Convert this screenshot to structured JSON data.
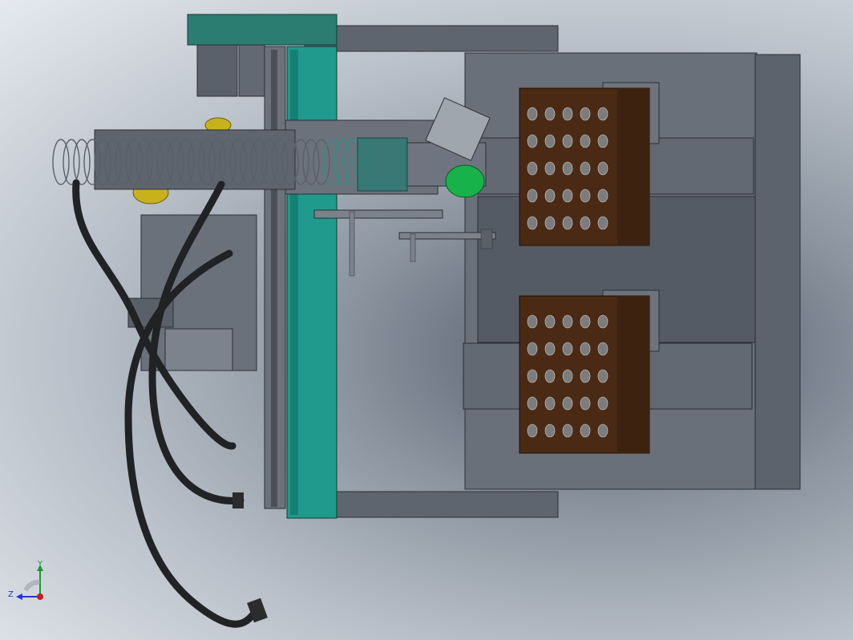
{
  "viewport": {
    "background_colors": [
      "#e6eaef",
      "#b9c0c9",
      "#4f5866"
    ]
  },
  "colors": {
    "frame": "#686e79",
    "frame_dark": "#505661",
    "teal_rail": "#1f9a8c",
    "teal_motor": "#2b7d72",
    "tray": "#4a2a14",
    "tray_hole": "#7c7c7c",
    "hose": "#202224",
    "green_accent": "#17b24a",
    "yellow_accent": "#c8b21c",
    "coil": "#5a6068"
  },
  "trays": [
    {
      "rows": 5,
      "cols": 5
    },
    {
      "rows": 5,
      "cols": 5
    }
  ],
  "triad": {
    "y_label": "Y",
    "z_label": "Z",
    "icon": "coordinate-triad-icon"
  }
}
